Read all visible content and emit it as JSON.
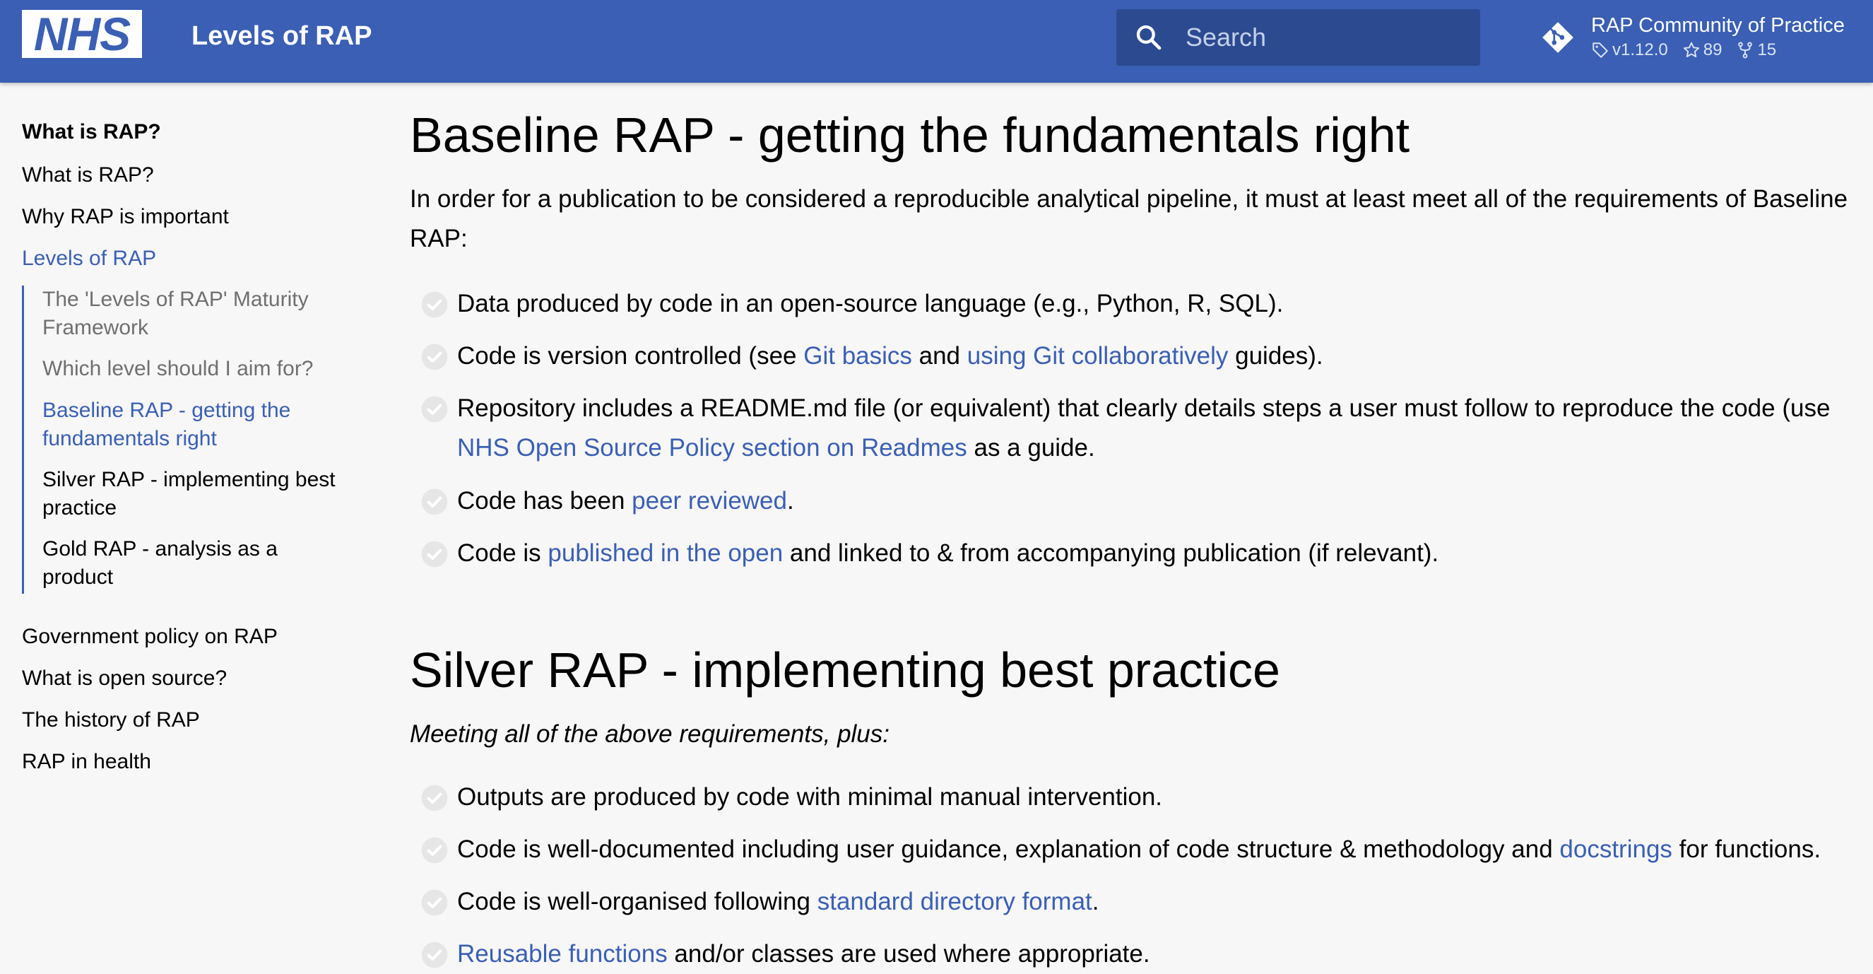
{
  "header": {
    "logo_text": "NHS",
    "site_title": "Levels of RAP",
    "search": {
      "placeholder": "Search"
    },
    "repo": {
      "name": "RAP Community of Practice",
      "version": "v1.12.0",
      "stars": "89",
      "forks": "15"
    },
    "colors": {
      "brand": "#3a5fb4",
      "search_bg": "#2b4a90"
    }
  },
  "sidebar": {
    "heading": "What is RAP?",
    "items_top": [
      {
        "label": "What is RAP?"
      },
      {
        "label": "Why RAP is important"
      },
      {
        "label": "Levels of RAP"
      }
    ],
    "subitems": [
      {
        "label": "The 'Levels of RAP' Maturity Framework"
      },
      {
        "label": "Which level should I aim for?"
      },
      {
        "label": "Baseline RAP - getting the fundamentals right"
      },
      {
        "label": "Silver RAP - implementing best practice"
      },
      {
        "label": "Gold RAP - analysis as a product"
      }
    ],
    "items_bottom": [
      {
        "label": "Government policy on RAP"
      },
      {
        "label": "What is open source?"
      },
      {
        "label": "The history of RAP"
      },
      {
        "label": "RAP in health"
      }
    ]
  },
  "main": {
    "baseline": {
      "title": "Baseline RAP - getting the fundamentals right",
      "intro": "In order for a publication to be considered a reproducible analytical pipeline, it must at least meet all of the requirements of Baseline RAP:",
      "requirements": [
        {
          "t1": "Data produced by code in an open-source language (e.g., Python, R, SQL)."
        },
        {
          "t1": "Code is version controlled (see ",
          "l1": "Git basics",
          "t2": " and ",
          "l2": "using Git collaboratively",
          "t3": " guides)."
        },
        {
          "t1": "Repository includes a README.md file (or equivalent) that clearly details steps a user must follow to reproduce the code (use ",
          "l1": "NHS Open Source Policy section on Readmes",
          "t2": " as a guide."
        },
        {
          "t1": "Code has been ",
          "l1": "peer reviewed",
          "t2": "."
        },
        {
          "t1": "Code is ",
          "l1": "published in the open",
          "t2": " and linked to & from accompanying publication (if relevant)."
        }
      ]
    },
    "silver": {
      "title": "Silver RAP - implementing best practice",
      "intro": "Meeting all of the above requirements, plus:",
      "requirements": [
        {
          "t1": "Outputs are produced by code with minimal manual intervention."
        },
        {
          "t1": "Code is well-documented including user guidance, explanation of code structure & methodology and ",
          "l1": "docstrings",
          "t2": " for functions."
        },
        {
          "t1": "Code is well-organised following ",
          "l1": "standard directory format",
          "t2": "."
        },
        {
          "l1": "Reusable functions",
          "t1": " and/or classes are used where appropriate."
        }
      ]
    }
  }
}
